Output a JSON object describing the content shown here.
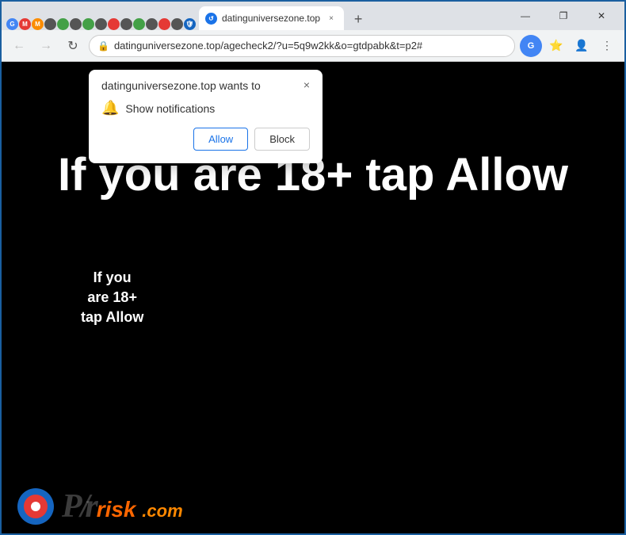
{
  "browser": {
    "tab": {
      "label": "datinguniversezone.top",
      "close_label": "×"
    },
    "new_tab_icon": "+",
    "window_controls": {
      "minimize": "—",
      "maximize": "❐",
      "close": "✕"
    },
    "nav": {
      "back_icon": "←",
      "forward_icon": "→",
      "refresh_icon": "↻",
      "address": "datinguniversezone.top/agecheck2/?u=5q9w2kk&o=gtdpabk&t=p2#",
      "lock_icon": "🔒"
    }
  },
  "popup": {
    "title": "datinguniversezone.top wants to",
    "close_icon": "×",
    "bell_icon": "🔔",
    "notification_text": "Show notifications",
    "allow_label": "Allow",
    "block_label": "Block"
  },
  "page": {
    "main_text": "If you are 18+ tap Allow",
    "side_text": "If you\nare 18+\ntap Allow"
  },
  "watermark": {
    "slash_text": "P/r",
    "risk_text": "risk",
    "com_text": ".com"
  }
}
